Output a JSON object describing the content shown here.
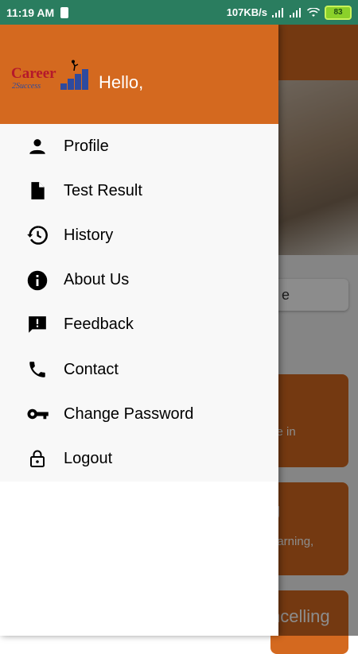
{
  "status_bar": {
    "time": "11:19 AM",
    "network_speed": "107KB/s",
    "battery_level": "83"
  },
  "drawer": {
    "logo_text": "Career",
    "logo_subtext": "2Success",
    "greeting": "Hello,",
    "items": [
      {
        "label": "Profile",
        "icon": "person-icon"
      },
      {
        "label": "Test Result",
        "icon": "document-icon"
      },
      {
        "label": "History",
        "icon": "history-icon"
      },
      {
        "label": "About Us",
        "icon": "info-icon"
      },
      {
        "label": "Feedback",
        "icon": "feedback-icon"
      },
      {
        "label": "Contact",
        "icon": "phone-icon"
      },
      {
        "label": "Change Password",
        "icon": "key-icon"
      },
      {
        "label": "Logout",
        "icon": "lock-icon"
      }
    ]
  },
  "background": {
    "search_partial": "e",
    "card1_line2": "ce in",
    "card2_title": "g",
    "card2_line2": "earning,",
    "card3_title": "ncelling"
  },
  "colors": {
    "accent": "#d4691f",
    "status_bar": "#2a7d5f"
  }
}
